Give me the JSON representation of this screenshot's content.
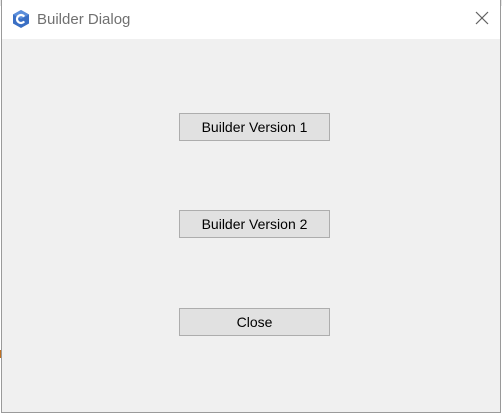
{
  "window": {
    "title": "Builder Dialog",
    "app_icon": "csharp-hex-icon",
    "close_icon": "close-icon"
  },
  "buttons": {
    "builder_v1_label": "Builder Version 1",
    "builder_v2_label": "Builder Version 2",
    "close_label": "Close"
  },
  "colors": {
    "icon_blue": "#3a6fc4",
    "dialog_bg": "#f0f0f0",
    "button_bg": "#e1e1e1",
    "button_border": "#adadad"
  }
}
